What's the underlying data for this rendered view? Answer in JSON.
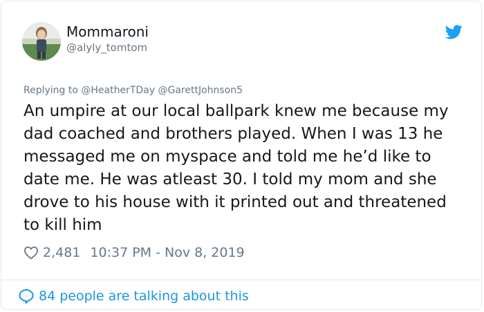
{
  "author": {
    "display_name": "Mommaroni",
    "handle": "@alyly_tomtom"
  },
  "reply_context": "Replying to @HeatherTDay @GarettJohnson5",
  "tweet": {
    "text": "An umpire at our local ballpark knew me because my dad coached and brothers played. When I was 13 he messaged me on myspace and told me he’d like to date me. He was atleast 30. I told my mom and she drove to his house with it printed out and threatened to kill him"
  },
  "stats": {
    "likes": "2,481",
    "timestamp": "10:37 PM - Nov 8, 2019"
  },
  "conversation_link": "84 people are talking about this",
  "icons": {
    "brand": "twitter-bird-icon",
    "like": "heart-icon",
    "conversation": "speech-bubble-icon"
  },
  "colors": {
    "twitter_blue": "#1da1f2",
    "link_blue": "#1b95e0",
    "muted_text": "#657786",
    "text": "#14171a",
    "border": "#e1e8ed"
  }
}
